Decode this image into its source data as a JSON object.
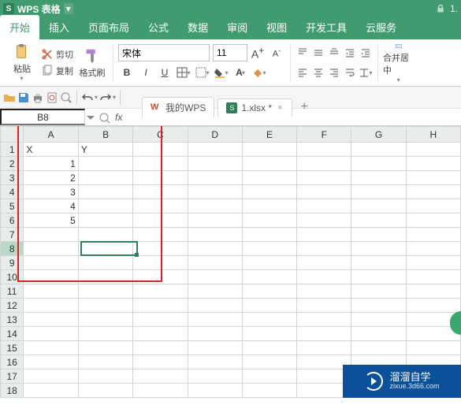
{
  "titlebar": {
    "app": "WPS 表格",
    "file_indicator": "1."
  },
  "tabs": {
    "items": [
      "开始",
      "插入",
      "页面布局",
      "公式",
      "数据",
      "审阅",
      "视图",
      "开发工具",
      "云服务"
    ],
    "active_index": 0
  },
  "ribbon": {
    "paste": "粘贴",
    "cut": "剪切",
    "copy": "复制",
    "format_painter": "格式刷",
    "font_name": "宋体",
    "font_size": "11",
    "merge_center": "合并居中"
  },
  "doctabs": {
    "items": [
      {
        "label": "我的WPS",
        "closable": false,
        "icon": "w"
      },
      {
        "label": "1.xlsx *",
        "closable": true,
        "icon": "s"
      }
    ]
  },
  "formula_bar": {
    "name_box": "B8"
  },
  "sheet": {
    "columns_visible": [
      "A",
      "B",
      "C",
      "D",
      "E",
      "F",
      "G",
      "H"
    ],
    "row_count_visible": 18,
    "active_cell": "B8",
    "selected_row": 8,
    "data": {
      "A1": "X",
      "B1": "Y",
      "A2": "1",
      "A3": "2",
      "A4": "3",
      "A5": "4",
      "A6": "5"
    },
    "highlight_box": {
      "r1": 1,
      "c1": "A",
      "r2": 9,
      "c2": "B"
    }
  },
  "watermark": {
    "brand": "溜溜自学",
    "url": "zixue.3d66.com"
  },
  "colors": {
    "brand_green": "#409b6e",
    "cell_select": "#2f8059",
    "red_box": "#e02020",
    "watermark_bg": "#0a519a"
  }
}
